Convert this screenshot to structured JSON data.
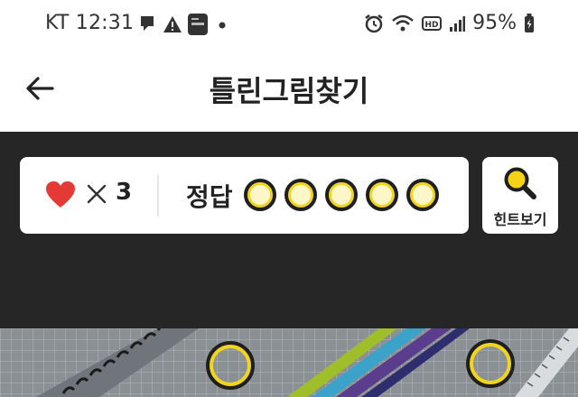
{
  "status_bar": {
    "carrier": "KT",
    "time": "12:31",
    "battery": "95%"
  },
  "header": {
    "title": "틀린그림찾기"
  },
  "game": {
    "lives_count": "3",
    "answer_label": "정답",
    "answer_slots_total": 5,
    "hint_label": "힌트보기"
  },
  "icons": {
    "back": "arrow-left-icon",
    "heart": "heart-icon",
    "times": "times-icon",
    "hint": "magnifier-icon"
  },
  "colors": {
    "game_background": "#262626",
    "heart": "#e53935",
    "slot_ring": "#f3d51d"
  }
}
